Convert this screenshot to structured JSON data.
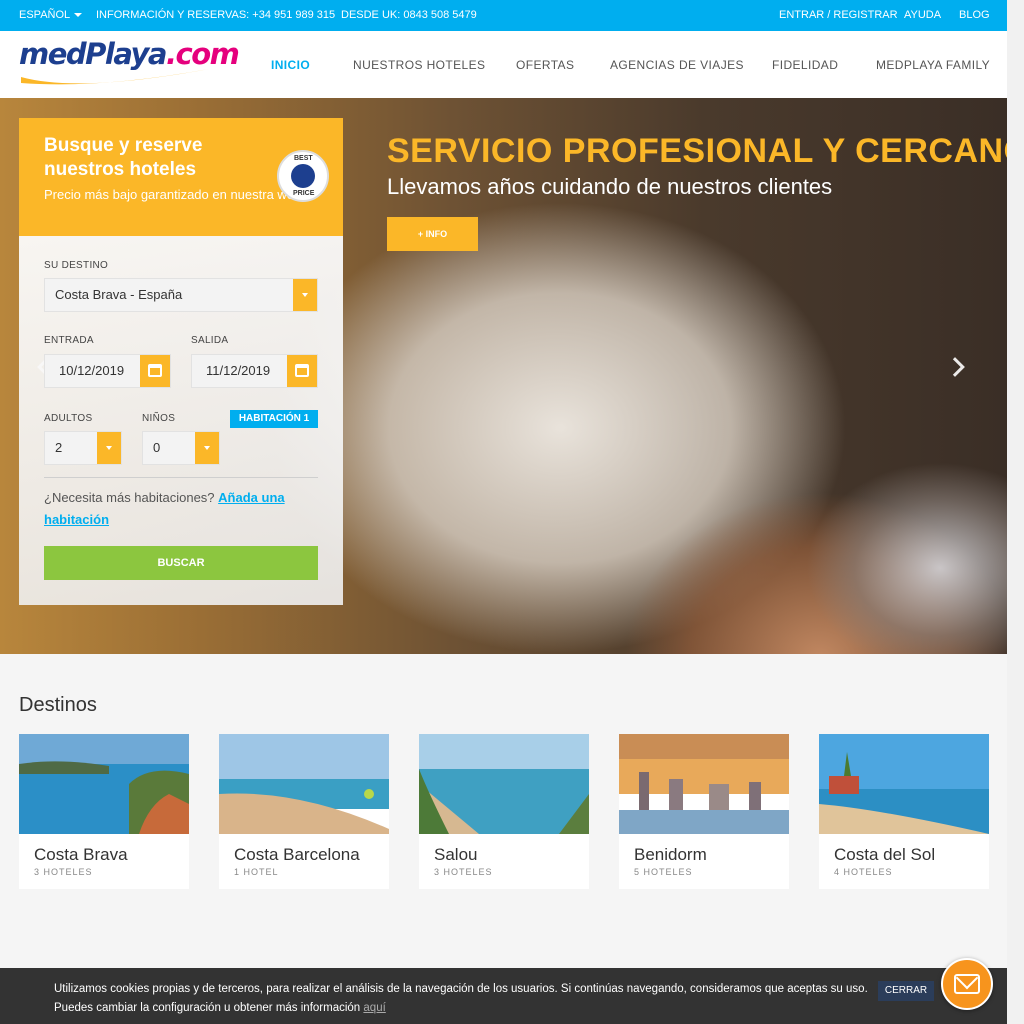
{
  "topbar": {
    "language": "ESPAÑOL",
    "info": "INFORMACIÓN Y RESERVAS: +34 951 989 315",
    "uk": "DESDE UK: 0843 508 5479",
    "login": "ENTRAR / REGISTRAR",
    "help": "AYUDA",
    "blog": "BLOG"
  },
  "header": {
    "logo_main": "medPlaya",
    "logo_dot": ".com",
    "nav": [
      "INICIO",
      "NUESTROS HOTELES",
      "OFERTAS",
      "AGENCIAS DE VIAJES",
      "FIDELIDAD",
      "MEDPLAYA FAMILY"
    ]
  },
  "hero": {
    "title": "SERVICIO PROFESIONAL Y CERCANO",
    "subtitle": "Llevamos años cuidando de nuestros clientes",
    "button": "+ INFO"
  },
  "booking": {
    "title": "Busque y reserve nuestros hoteles",
    "subtitle": "Precio más bajo garantizado en nuestra web",
    "badge_top": "BEST",
    "badge_bottom": "PRICE",
    "destination_label": "SU DESTINO",
    "destination_value": "Costa Brava - España",
    "checkin_label": "ENTRADA",
    "checkin_value": "10/12/2019",
    "checkout_label": "SALIDA",
    "checkout_value": "11/12/2019",
    "adults_label": "ADULTOS",
    "adults_value": "2",
    "children_label": "NIÑOS",
    "children_value": "0",
    "room_badge": "HABITACIÓN 1",
    "more_rooms_text": "¿Necesita más habitaciones?",
    "more_rooms_link": "Añada una habitación",
    "search_button": "BUSCAR"
  },
  "destinations": {
    "title": "Destinos",
    "items": [
      {
        "name": "Costa Brava",
        "count": "3 HOTELES"
      },
      {
        "name": "Costa Barcelona",
        "count": "1 HOTEL"
      },
      {
        "name": "Salou",
        "count": "3 HOTELES"
      },
      {
        "name": "Benidorm",
        "count": "5 HOTELES"
      },
      {
        "name": "Costa del Sol",
        "count": "4 HOTELES"
      }
    ]
  },
  "cookie": {
    "line1": "Utilizamos cookies propias y de terceros, para realizar el análisis de la navegación de los usuarios. Si continúas navegando, consideramos que aceptas su uso.",
    "line2": "Puedes cambiar la configuración u obtener más información",
    "link": "aquí",
    "close": "CERRAR"
  },
  "colors": {
    "accent_blue": "#00aeef",
    "accent_yellow": "#fbb728",
    "search_green": "#8cc63f",
    "logo_blue": "#1d3f8f",
    "logo_magenta": "#e5007d",
    "chat_orange": "#f7941d"
  }
}
